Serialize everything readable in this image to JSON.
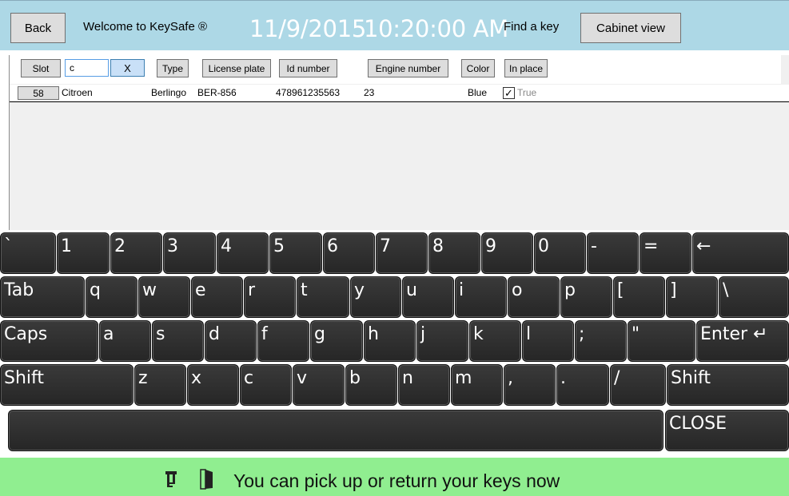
{
  "header": {
    "back_label": "Back",
    "welcome_text": "Welcome to KeySafe ®",
    "date": "11/9/2015",
    "time": "10:20:00 AM",
    "find_label": "Find a key",
    "cabinet_label": "Cabinet view"
  },
  "grid": {
    "columns": {
      "slot": "Slot",
      "type": "Type",
      "license_plate": "License plate",
      "id_number": "Id number",
      "engine_number": "Engine number",
      "color": "Color",
      "in_place": "In place"
    },
    "filter_value": "c",
    "filter_clear": "X",
    "rows": [
      {
        "slot": "58",
        "make": "Citroen",
        "type": "Berlingo",
        "license_plate": "BER-856",
        "id_number": "478961235563",
        "engine_number": "23",
        "color": "Blue",
        "in_place_checked": true,
        "in_place_text": "True"
      }
    ]
  },
  "keyboard": {
    "row1": [
      "`",
      "1",
      "2",
      "3",
      "4",
      "5",
      "6",
      "7",
      "8",
      "9",
      "0",
      "-",
      "=",
      "←"
    ],
    "row2": [
      "Tab",
      "q",
      "w",
      "e",
      "r",
      "t",
      "y",
      "u",
      "i",
      "o",
      "p",
      "[",
      "]",
      "\\"
    ],
    "row3": [
      "Caps",
      "a",
      "s",
      "d",
      "f",
      "g",
      "h",
      "j",
      "k",
      "l",
      ";",
      "\"",
      "Enter ↵"
    ],
    "row4": [
      "Shift",
      "z",
      "x",
      "c",
      "v",
      "b",
      "n",
      "m",
      ",",
      ".",
      "/",
      "Shift"
    ],
    "space_label": "",
    "close_label": "CLOSE"
  },
  "status": {
    "message": "You can pick up or return your keys now",
    "icons": [
      "key-icon",
      "door-icon"
    ],
    "background": "#90EE90"
  },
  "colors": {
    "header_bg": "#ADD8E6",
    "key_bg": "#2B2B2B",
    "status_bg": "#90EE90"
  }
}
